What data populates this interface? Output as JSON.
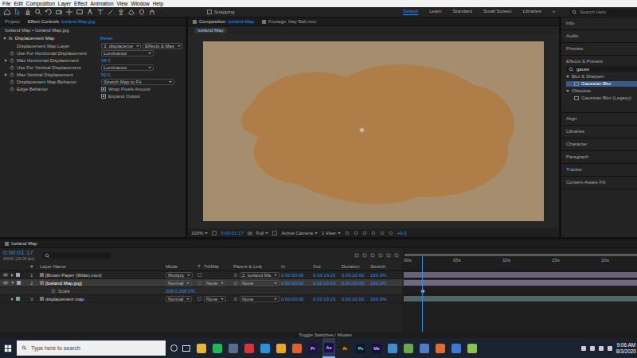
{
  "menu": [
    "File",
    "Edit",
    "Composition",
    "Layer",
    "Effect",
    "Animation",
    "View",
    "Window",
    "Help"
  ],
  "toolbar": {
    "snapping": {
      "label": "Snapping",
      "checked": false
    },
    "workspaces": [
      {
        "label": "Default",
        "selected": true
      },
      {
        "label": "Learn",
        "selected": false
      },
      {
        "label": "Standard",
        "selected": false
      },
      {
        "label": "Small Screen",
        "selected": false
      },
      {
        "label": "Libraries",
        "selected": false
      }
    ],
    "overflow": "»",
    "search": {
      "placeholder": "Search Help"
    }
  },
  "effect_controls": {
    "tabs": [
      {
        "label": "Project",
        "file": "",
        "selected": false
      },
      {
        "label": "Effect Controls",
        "file": "Iceland Map.jpg",
        "selected": true
      }
    ],
    "header": "Iceland Map • Iceland Map.jpg",
    "effect": {
      "badge": "fx",
      "name": "Displacement Map",
      "reset": "Reset",
      "expanded": true
    },
    "properties": [
      {
        "kind": "layer",
        "label": "Displacement Map Layer",
        "value": "3. displaceme",
        "source": "Effects & Mas",
        "expandable": false
      },
      {
        "kind": "dropdown",
        "label": "Use For Horizontal Displacement",
        "value": "Luminance",
        "expandable": false
      },
      {
        "kind": "number",
        "label": "Max Horizontal Displacement",
        "value": "28.0",
        "expandable": true
      },
      {
        "kind": "dropdown",
        "label": "Use For Vertical Displacement",
        "value": "Luminance",
        "expandable": false
      },
      {
        "kind": "number",
        "label": "Max Vertical Displacement",
        "value": "50.0",
        "expandable": true
      },
      {
        "kind": "wide",
        "label": "Displacement Map Behavior",
        "value": "Stretch Map to Fit",
        "expandable": false
      },
      {
        "kind": "checkbox",
        "label": "Edge Behavior",
        "value": "Wrap Pixels Around",
        "checked": true,
        "expandable": false
      },
      {
        "kind": "checkbox",
        "label": "",
        "value": "Expand Output",
        "checked": true,
        "expandable": false
      }
    ]
  },
  "composition": {
    "tabs": [
      {
        "label": "Composition",
        "name": "Iceland Map",
        "selected": true
      },
      {
        "label": "Footage",
        "name": "Hay Bail.mov",
        "selected": false
      }
    ],
    "breadcrumb": "Iceland Map",
    "footer": {
      "zoom": "100%",
      "time": "0:00:01:17",
      "resolution": "Full",
      "camera": "Active Camera",
      "views": "1 View",
      "exposure": "+0.0"
    }
  },
  "right_panel": {
    "panels_top": [
      "Info",
      "Audio",
      "Preview"
    ],
    "effects": {
      "title": "Effects & Presets",
      "search": "gauss",
      "groups": [
        {
          "name": "Blur & Sharpen",
          "expanded": true,
          "items": [
            {
              "label": "Gaussian Blur",
              "selected": true
            }
          ]
        },
        {
          "name": "Obsolete",
          "expanded": true,
          "items": [
            {
              "label": "Gaussian Blur (Legacy)",
              "selected": false
            }
          ]
        }
      ]
    },
    "panels_bottom": [
      "Align",
      "Libraries",
      "Character",
      "Paragraph",
      "Tracker",
      "Content-Aware Fill"
    ]
  },
  "timeline": {
    "tab": "Iceland Map",
    "time": "0:00:01:17",
    "frames": "00041 (24.00 fps)",
    "columns": [
      "Layer Name",
      "Mode",
      "T",
      "TrkMat",
      "Parent & Link",
      "In",
      "Out",
      "Duration",
      "Stretch"
    ],
    "ruler": [
      "00s",
      "05s",
      "10s",
      "15s",
      "20s"
    ],
    "playhead": 0.08,
    "layers": [
      {
        "number": "1",
        "name": "[Brown Paper (Wide).mov]",
        "mode": "Multiply",
        "trkmat": "",
        "parent": "2. Iceland Ma",
        "in": "0:00:00:00",
        "out": "0:03:19:23",
        "duration": "0:03:20:00",
        "stretch": "100.0%",
        "visible": true,
        "selected": false,
        "expanded": false,
        "color": "#a99bc4"
      },
      {
        "number": "2",
        "name": "[Iceland Map.jpg]",
        "mode": "Normal",
        "trkmat": "None",
        "parent": "None",
        "in": "0:00:00:00",
        "out": "0:03:19:23",
        "duration": "0:03:20:00",
        "stretch": "100.0%",
        "visible": true,
        "selected": true,
        "expanded": true,
        "color": "#a99bc4"
      },
      {
        "number": "3",
        "name": "displacement map",
        "mode": "Normal",
        "trkmat": "None",
        "parent": "None",
        "in": "0:00:00:00",
        "out": "0:03:19:23",
        "duration": "0:03:20:00",
        "stretch": "100.0%",
        "visible": false,
        "selected": false,
        "expanded": false,
        "color": "#7fa0a0"
      }
    ],
    "sub": {
      "label": "Scale",
      "value": "208.0,208.0%"
    },
    "footer": "Toggle Switches / Modes"
  },
  "taskbar": {
    "search": "Type here to search",
    "apps": [
      {
        "label": "",
        "color": "#e8b73a",
        "selected": false
      },
      {
        "label": "",
        "color": "#1db954",
        "selected": false
      },
      {
        "label": "",
        "color": "#5a6e8c",
        "selected": false
      },
      {
        "label": "",
        "color": "#d6353a",
        "selected": false
      },
      {
        "label": "",
        "color": "#2f8fd8",
        "selected": false
      },
      {
        "label": "",
        "color": "#e7a727",
        "selected": false
      },
      {
        "label": "",
        "color": "#e2602a",
        "selected": false
      },
      {
        "label": "Pr",
        "color": "#2a0a4e",
        "selected": false
      },
      {
        "label": "Ae",
        "color": "#1f0a4e",
        "selected": true
      },
      {
        "label": "Ai",
        "color": "#331c00",
        "selected": false
      },
      {
        "label": "Ps",
        "color": "#001d34",
        "selected": false
      },
      {
        "label": "Me",
        "color": "#1f0a4e",
        "selected": false
      },
      {
        "label": "",
        "color": "#3d8fd0",
        "selected": false
      },
      {
        "label": "",
        "color": "#6aa84f",
        "selected": false
      },
      {
        "label": "",
        "color": "#4d7cc9",
        "selected": false
      },
      {
        "label": "",
        "color": "#e06c2f",
        "selected": false
      },
      {
        "label": "",
        "color": "#3c78d8",
        "selected": false
      },
      {
        "label": "",
        "color": "#8bc34a",
        "selected": false
      }
    ],
    "time": "9:06 AM",
    "date": "8/3/2020"
  }
}
